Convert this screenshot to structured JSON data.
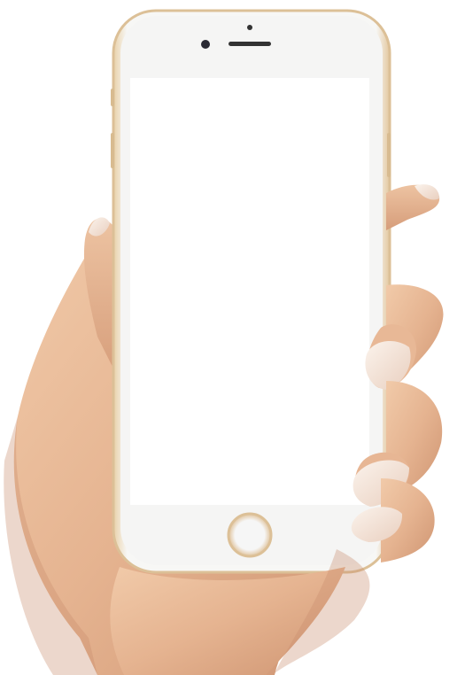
{
  "scene": {
    "subject": "hand-holding-phone",
    "background": "#ffffff",
    "skin": "#e8bd9c",
    "skin_shadow": "#c98f6e",
    "nail": "#f6e9df",
    "phone_frame": "#f4f4f2",
    "phone_trim": "#e0c49a",
    "screen": "#ffffff"
  }
}
